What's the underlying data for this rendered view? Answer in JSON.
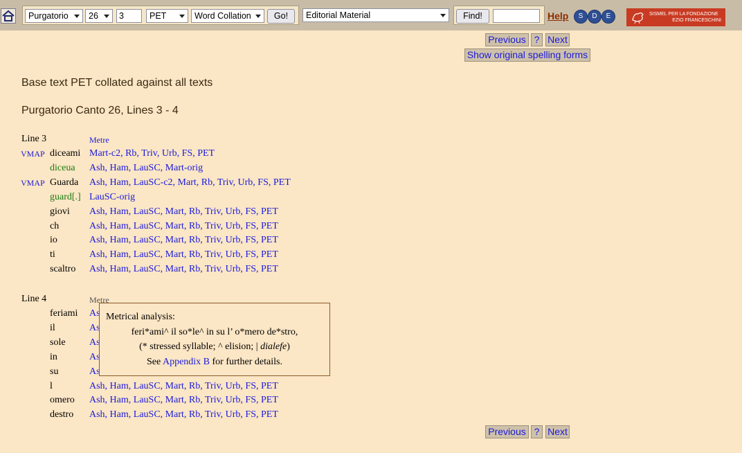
{
  "toolbar": {
    "canticle": "Purgatorio",
    "canto": "26",
    "line": "3",
    "base_text": "PET",
    "mode": "Word Collation",
    "go_label": "Go!",
    "material": "Editorial Material",
    "find_label": "Find!",
    "find_value": "",
    "help_label": "Help",
    "sde": [
      "S",
      "D",
      "E"
    ],
    "logo_line1": "SISMEL PER LA FONDAZIONE",
    "logo_line2": "EZIO FRANCESCHINI"
  },
  "nav": {
    "previous": "Previous",
    "question": "?",
    "next": "Next",
    "show_original": "Show original spelling forms"
  },
  "heading1": "Base text PET collated against all texts",
  "heading2": "Purgatorio Canto 26, Lines 3 - 4",
  "lines": [
    {
      "label": "Line 3",
      "metre": "Metre",
      "rows": [
        {
          "vmap": "VMAP",
          "word": "diceami",
          "variant": false,
          "witnesses": "Mart-c2, Rb, Triv, Urb, FS, PET"
        },
        {
          "vmap": "",
          "word": "diceua",
          "variant": true,
          "witnesses": "Ash, Ham, LauSC, Mart-orig"
        },
        {
          "vmap": "VMAP",
          "word": "Guarda",
          "variant": false,
          "witnesses": "Ash, Ham, LauSC-c2, Mart, Rb, Triv, Urb, FS, PET"
        },
        {
          "vmap": "",
          "word": "guard[.]",
          "variant": true,
          "witnesses": "LauSC-orig"
        },
        {
          "vmap": "",
          "word": "giovi",
          "variant": false,
          "witnesses": "Ash, Ham, LauSC, Mart, Rb, Triv, Urb, FS, PET"
        },
        {
          "vmap": "",
          "word": "ch",
          "variant": false,
          "witnesses": "Ash, Ham, LauSC, Mart, Rb, Triv, Urb, FS, PET"
        },
        {
          "vmap": "",
          "word": "io",
          "variant": false,
          "witnesses": "Ash, Ham, LauSC, Mart, Rb, Triv, Urb, FS, PET"
        },
        {
          "vmap": "",
          "word": "ti",
          "variant": false,
          "witnesses": "Ash, Ham, LauSC, Mart, Rb, Triv, Urb, FS, PET"
        },
        {
          "vmap": "",
          "word": "scaltro",
          "variant": false,
          "witnesses": "Ash, Ham, LauSC, Mart, Rb, Triv, Urb, FS, PET"
        }
      ]
    },
    {
      "label": "Line 4",
      "metre": "Metre",
      "rows": [
        {
          "vmap": "",
          "word": "feriami",
          "variant": false,
          "witnesses": "As"
        },
        {
          "vmap": "",
          "word": "il",
          "variant": false,
          "witnesses": "As"
        },
        {
          "vmap": "",
          "word": "sole",
          "variant": false,
          "witnesses": "As"
        },
        {
          "vmap": "",
          "word": "in",
          "variant": false,
          "witnesses": "As"
        },
        {
          "vmap": "",
          "word": "su",
          "variant": false,
          "witnesses": "As"
        },
        {
          "vmap": "",
          "word": "l",
          "variant": false,
          "witnesses": "Ash, Ham, LauSC, Mart, Rb, Triv, Urb, FS, PET"
        },
        {
          "vmap": "",
          "word": "omero",
          "variant": false,
          "witnesses": "Ash, Ham, LauSC, Mart, Rb, Triv, Urb, FS, PET"
        },
        {
          "vmap": "",
          "word": "destro",
          "variant": false,
          "witnesses": "Ash, Ham, LauSC, Mart, Rb, Triv, Urb, FS, PET"
        }
      ]
    }
  ],
  "popup": {
    "title": "Metrical analysis:",
    "scansion": "feri*ami^ il so*le^ in su l’ o*mero de*stro,",
    "legend_a": "(* stressed syllable; ^ elision; | ",
    "legend_em": "dialefe",
    "legend_b": ")",
    "see": "See ",
    "appendix": "Appendix B",
    "details": " for further details."
  }
}
